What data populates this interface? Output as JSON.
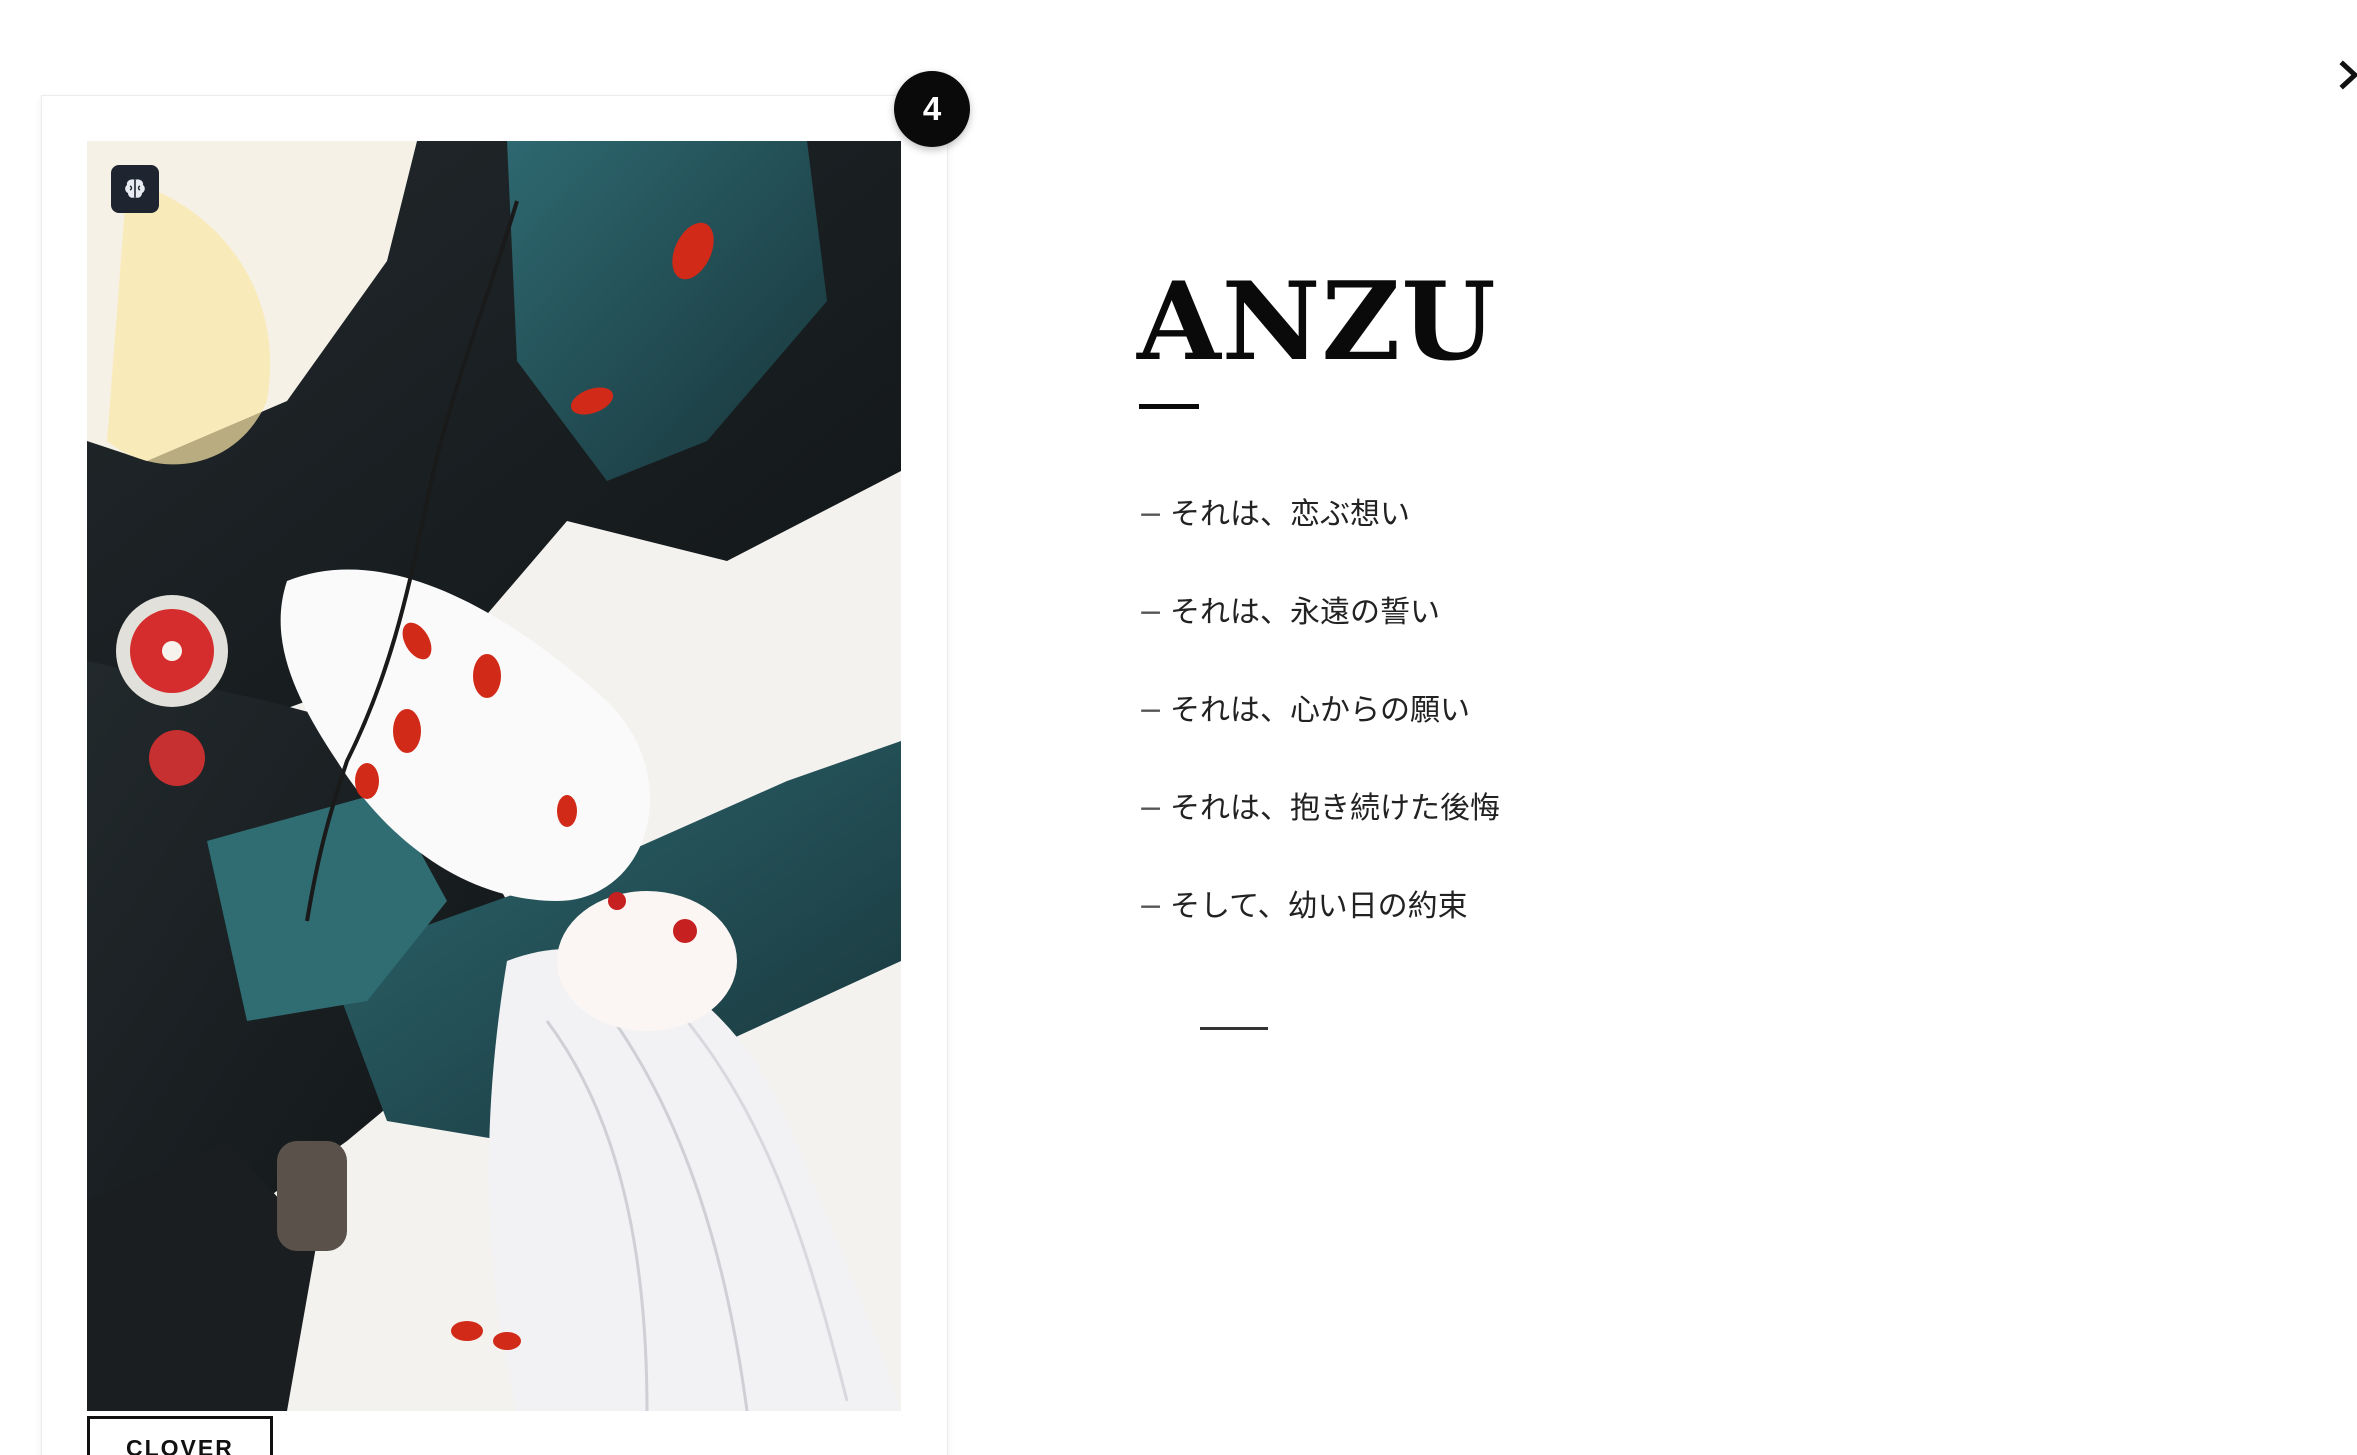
{
  "modal": {
    "close_icon": "chevron-right-icon",
    "card": {
      "number": "4",
      "badge_icon": "brain-icon",
      "tag": "CLOVER"
    },
    "title": "ANZU",
    "lines": [
      "それは、恋ぶ想い",
      "それは、永遠の誓い",
      "それは、心からの願い",
      "それは、抱き続けた後悔",
      "そして、幼い日の約束"
    ],
    "line_marker": "−",
    "ending": "——"
  },
  "colors": {
    "accent": "#0a0a0a",
    "background": "#ffffff",
    "artwork_red": "#c62020",
    "artwork_teal": "#2b5f66"
  }
}
